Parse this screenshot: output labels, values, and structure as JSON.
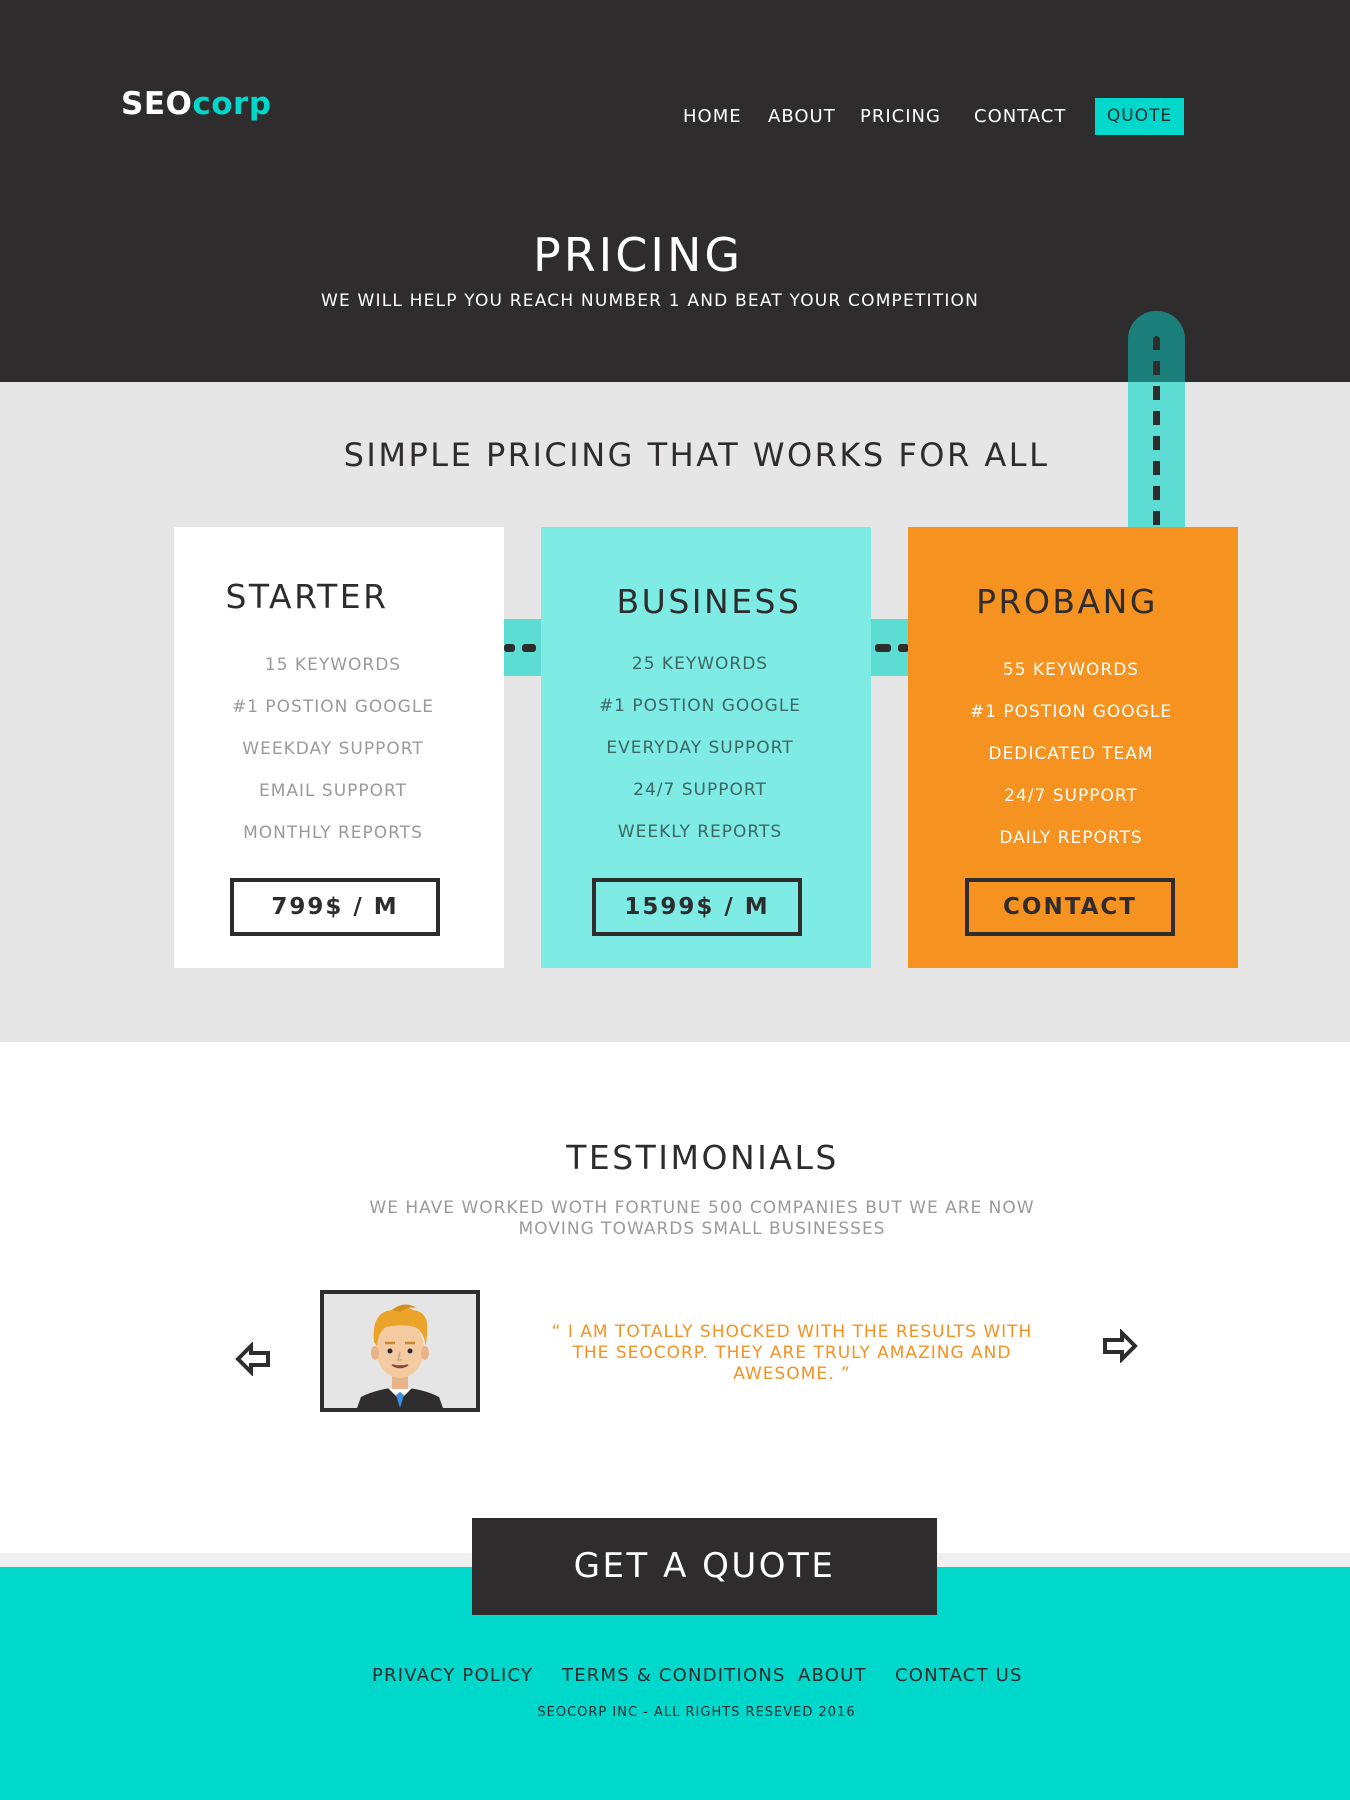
{
  "brand": {
    "logo_part1": "SEO",
    "logo_part2": "corp",
    "accent": "#00d8cc",
    "dark": "#2f2c2d",
    "orange": "#f69220",
    "light_teal": "#7eebe5"
  },
  "nav": {
    "items": [
      "HOME",
      "ABOUT",
      "PRICING",
      "CONTACT"
    ],
    "quote": "QUOTE"
  },
  "hero": {
    "title": "PRICING",
    "subtitle": "WE WILL HELP YOU REACH NUMBER 1 AND BEAT YOUR COMPETITION"
  },
  "pricing": {
    "title": "SIMPLE PRICING THAT WORKS FOR ALL",
    "plans": [
      {
        "name": "STARTER",
        "features": [
          "15 KEYWORDS",
          "#1 POSTION GOOGLE",
          "WEEKDAY SUPPORT",
          "EMAIL SUPPORT",
          "MONTHLY REPORTS"
        ],
        "button": "799$ / M"
      },
      {
        "name": "BUSINESS",
        "features": [
          "25 KEYWORDS",
          "#1 POSTION GOOGLE",
          "EVERYDAY SUPPORT",
          "24/7  SUPPORT",
          "WEEKLY REPORTS"
        ],
        "button": "1599$ / M"
      },
      {
        "name": "PROBANG",
        "features": [
          "55 KEYWORDS",
          "#1 POSTION GOOGLE",
          "DEDICATED TEAM",
          "24/7  SUPPORT",
          "DAILY REPORTS"
        ],
        "button": "CONTACT"
      }
    ]
  },
  "testimonials": {
    "title": "TESTIMONIALS",
    "subtitle_line1": "WE HAVE WORKED WOTH FORTUNE 500 COMPANIES BUT WE ARE NOW",
    "subtitle_line2": "MOVING TOWARDS SMALL BUSINESSES",
    "quote_line1": "“ I AM TOTALLY SHOCKED WITH THE RESULTS WITH",
    "quote_line2": "THE SEOCORP. THEY ARE TRULY AMAZING AND",
    "quote_line3": "AWESOME. ”",
    "prev_icon": "arrow-left-icon",
    "next_icon": "arrow-right-icon"
  },
  "cta": {
    "label": "GET A QUOTE"
  },
  "footer": {
    "links": [
      "PRIVACY POLICY",
      "TERMS & CONDITIONS",
      "ABOUT",
      "CONTACT US"
    ],
    "copyright": "SEOCORP INC -  ALL RIGHTS RESEVED 2016"
  }
}
